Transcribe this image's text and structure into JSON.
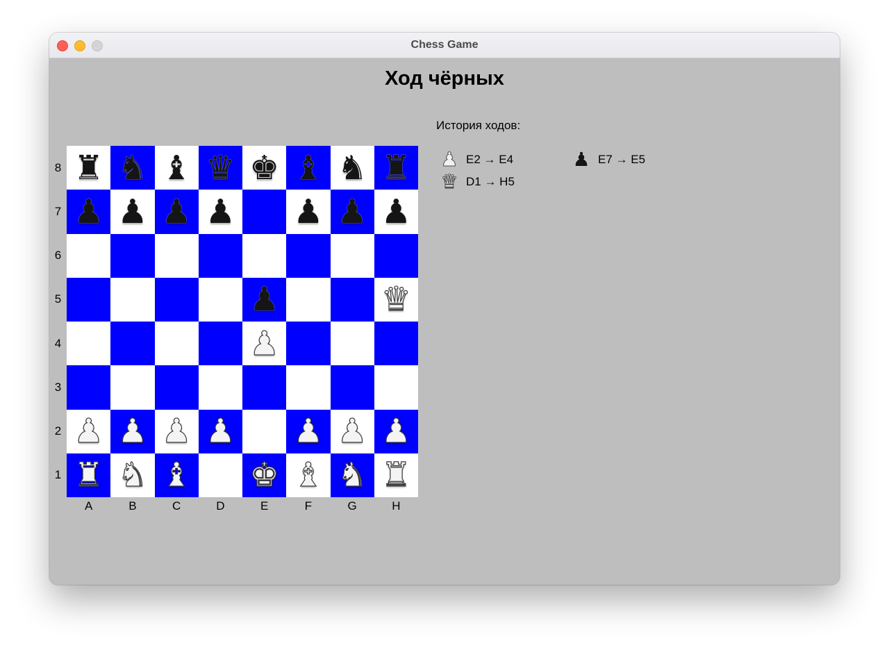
{
  "window": {
    "title": "Chess Game"
  },
  "status": {
    "turn_text": "Ход чёрных"
  },
  "board": {
    "colors": {
      "light": "#ffffff",
      "dark": "#0000ff"
    },
    "ranks": [
      "8",
      "7",
      "6",
      "5",
      "4",
      "3",
      "2",
      "1"
    ],
    "files": [
      "A",
      "B",
      "C",
      "D",
      "E",
      "F",
      "G",
      "H"
    ],
    "rows": [
      [
        {
          "p": "rook",
          "c": "black"
        },
        {
          "p": "knight",
          "c": "black"
        },
        {
          "p": "bishop",
          "c": "black"
        },
        {
          "p": "queen",
          "c": "black"
        },
        {
          "p": "king",
          "c": "black"
        },
        {
          "p": "bishop",
          "c": "black"
        },
        {
          "p": "knight",
          "c": "black"
        },
        {
          "p": "rook",
          "c": "black"
        }
      ],
      [
        {
          "p": "pawn",
          "c": "black"
        },
        {
          "p": "pawn",
          "c": "black"
        },
        {
          "p": "pawn",
          "c": "black"
        },
        {
          "p": "pawn",
          "c": "black"
        },
        null,
        {
          "p": "pawn",
          "c": "black"
        },
        {
          "p": "pawn",
          "c": "black"
        },
        {
          "p": "pawn",
          "c": "black"
        }
      ],
      [
        null,
        null,
        null,
        null,
        null,
        null,
        null,
        null
      ],
      [
        null,
        null,
        null,
        null,
        {
          "p": "pawn",
          "c": "black"
        },
        null,
        null,
        {
          "p": "queen",
          "c": "white"
        }
      ],
      [
        null,
        null,
        null,
        null,
        {
          "p": "pawn",
          "c": "white"
        },
        null,
        null,
        null
      ],
      [
        null,
        null,
        null,
        null,
        null,
        null,
        null,
        null
      ],
      [
        {
          "p": "pawn",
          "c": "white"
        },
        {
          "p": "pawn",
          "c": "white"
        },
        {
          "p": "pawn",
          "c": "white"
        },
        {
          "p": "pawn",
          "c": "white"
        },
        null,
        {
          "p": "pawn",
          "c": "white"
        },
        {
          "p": "pawn",
          "c": "white"
        },
        {
          "p": "pawn",
          "c": "white"
        }
      ],
      [
        {
          "p": "rook",
          "c": "white"
        },
        {
          "p": "knight",
          "c": "white"
        },
        {
          "p": "bishop",
          "c": "white"
        },
        null,
        {
          "p": "king",
          "c": "white"
        },
        {
          "p": "bishop",
          "c": "white"
        },
        {
          "p": "knight",
          "c": "white"
        },
        {
          "p": "rook",
          "c": "white"
        }
      ]
    ]
  },
  "history": {
    "title": "История ходов:",
    "moves": [
      {
        "piece": "pawn",
        "color": "white",
        "text": "E2 → E4"
      },
      {
        "piece": "pawn",
        "color": "black",
        "text": "E7 → E5"
      },
      {
        "piece": "queen",
        "color": "white",
        "text": "D1 → H5"
      }
    ]
  }
}
